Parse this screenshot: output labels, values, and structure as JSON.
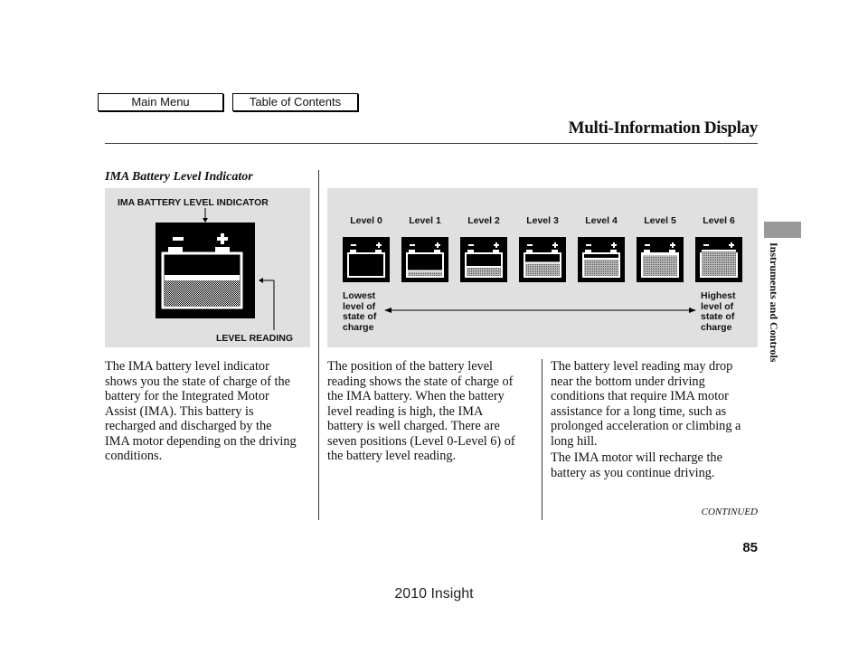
{
  "nav": {
    "main_menu": "Main Menu",
    "table_of_contents": "Table of Contents"
  },
  "header": {
    "title": "Multi-Information Display"
  },
  "section_title": "IMA Battery Level Indicator",
  "figure_left": {
    "label_top": "IMA BATTERY LEVEL INDICATOR",
    "label_bottom": "LEVEL READING"
  },
  "figure_right": {
    "levels": [
      {
        "label": "Level 0",
        "fill": 0
      },
      {
        "label": "Level 1",
        "fill": 1
      },
      {
        "label": "Level 2",
        "fill": 2
      },
      {
        "label": "Level 3",
        "fill": 3
      },
      {
        "label": "Level 4",
        "fill": 4
      },
      {
        "label": "Level 5",
        "fill": 5
      },
      {
        "label": "Level 6",
        "fill": 6
      }
    ],
    "lowest": "Lowest\nlevel of\nstate of\ncharge",
    "highest": "Highest\nlevel of\nstate of\ncharge"
  },
  "text": {
    "col1": "The IMA battery level indicator\nshows you the state of charge of the\nbattery for the Integrated Motor\nAssist (IMA). This battery is\nrecharged and discharged by the\nIMA motor depending on the driving\nconditions.",
    "col2": "The position of the battery level\nreading shows the state of charge of\nthe IMA battery. When the battery\nlevel reading is high, the IMA\nbattery is well charged. There are\nseven positions (Level 0-Level 6) of\nthe battery level reading.",
    "col3a": "The battery level reading may drop\nnear the bottom under driving\nconditions that require IMA motor\nassistance for a long time, such as\nprolonged acceleration or climbing a\nlong hill.",
    "col3b": "The IMA motor will recharge the\nbattery as you continue driving."
  },
  "side_tab": "Instruments and Controls",
  "continued": "CONTINUED",
  "page_number": "85",
  "footer": "2010 Insight"
}
